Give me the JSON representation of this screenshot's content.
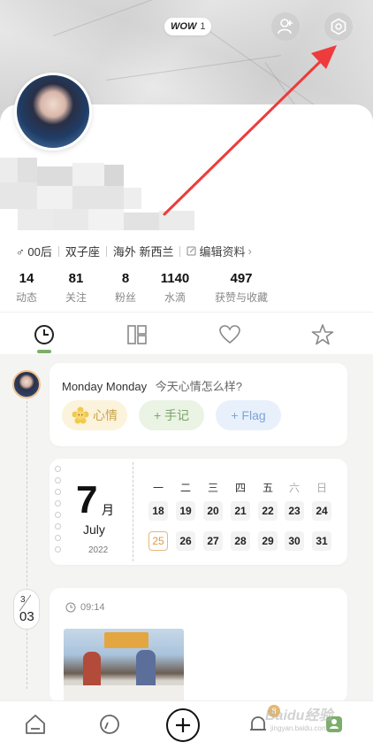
{
  "header": {
    "wow_label": "WOW",
    "wow_count": "1"
  },
  "profile": {
    "tags": {
      "gender_age": "♂ 00后",
      "zodiac": "双子座",
      "location": "海外 新西兰",
      "edit": "编辑资料"
    },
    "stats": [
      {
        "value": "14",
        "label": "动态"
      },
      {
        "value": "81",
        "label": "关注"
      },
      {
        "value": "8",
        "label": "粉丝"
      },
      {
        "value": "1140",
        "label": "水滴"
      },
      {
        "value": "497",
        "label": "获赞与收藏"
      }
    ]
  },
  "tabs": [
    "clock-tab",
    "grid-tab",
    "heart-tab",
    "star-tab"
  ],
  "mood_card": {
    "title": "Monday Monday",
    "question": "今天心情怎么样?",
    "buttons": {
      "mood": "心情",
      "note": "+ 手记",
      "flag": "+ Flag"
    },
    "colors": {
      "mood_bg": "#fbf3dc",
      "mood_fg": "#c9a54a",
      "note_bg": "#eaf3e4",
      "note_fg": "#7aa36a",
      "flag_bg": "#e8f0fb",
      "flag_fg": "#7ea3d6"
    }
  },
  "calendar": {
    "day": "7",
    "day_unit": "月",
    "month": "July",
    "year": "2022",
    "weekdays": [
      "一",
      "二",
      "三",
      "四",
      "五",
      "六",
      "日"
    ],
    "row1": [
      "18",
      "19",
      "20",
      "21",
      "22",
      "23",
      "24"
    ],
    "row2": [
      "25",
      "26",
      "27",
      "28",
      "29",
      "30",
      "31"
    ],
    "today": "25"
  },
  "post": {
    "date_month": "3",
    "date_day": "03",
    "time": "09:14"
  },
  "bottom_nav": {
    "badge": "8"
  },
  "watermark": {
    "line1": "Baidu经验",
    "line2": "jingyan.baidu.com"
  },
  "colors": {
    "accent_green": "#7cae6b",
    "arrow_red": "#ee3b3b"
  }
}
